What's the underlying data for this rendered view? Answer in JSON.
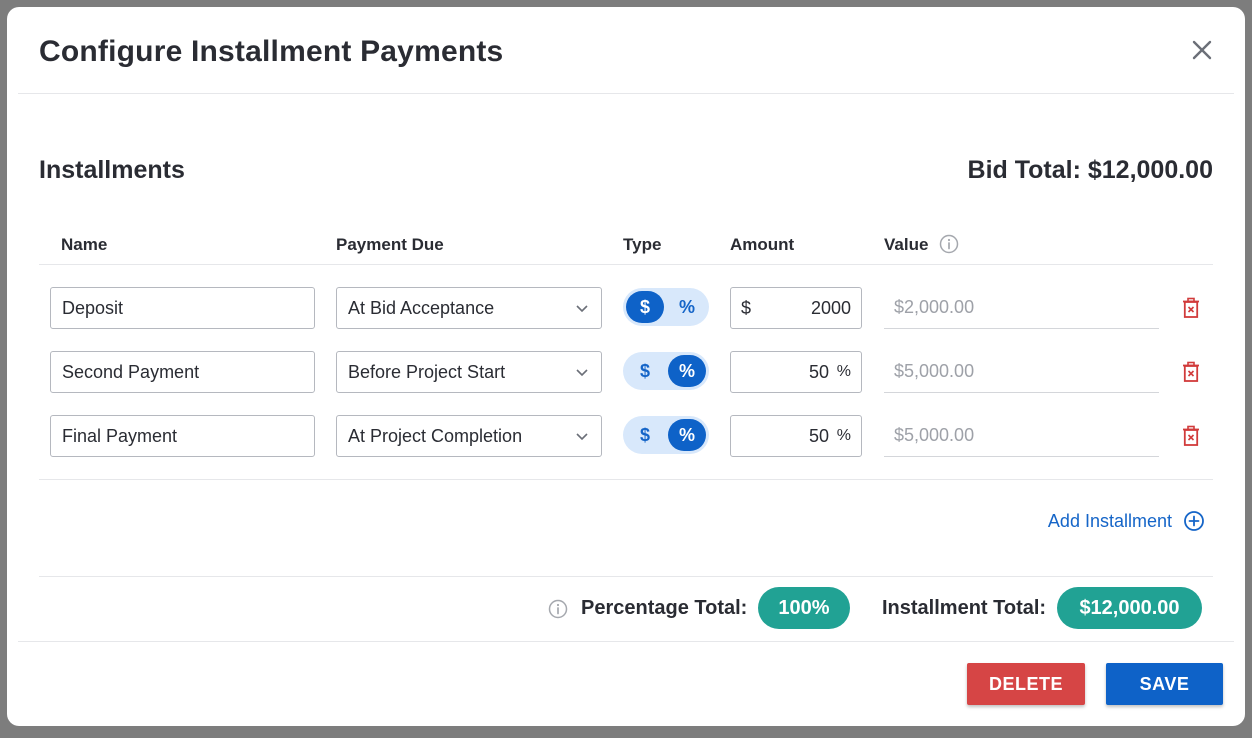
{
  "modal": {
    "title": "Configure Installment Payments",
    "close_icon": "close-icon"
  },
  "section": {
    "title": "Installments",
    "bid_total": "Bid Total: $12,000.00"
  },
  "columns": {
    "name": "Name",
    "payment_due": "Payment Due",
    "type": "Type",
    "amount": "Amount",
    "value": "Value"
  },
  "installments": [
    {
      "name": "Deposit",
      "payment_due": "At Bid Acceptance",
      "type_dollar": "$",
      "type_percent": "%",
      "active_type": "dollar",
      "amount_prefix": "$",
      "amount": "2000",
      "amount_suffix": "",
      "value": "$2,000.00"
    },
    {
      "name": "Second Payment",
      "payment_due": "Before Project Start",
      "type_dollar": "$",
      "type_percent": "%",
      "active_type": "percent",
      "amount_prefix": "",
      "amount": "50",
      "amount_suffix": "%",
      "value": "$5,000.00"
    },
    {
      "name": "Final Payment",
      "payment_due": "At Project Completion",
      "type_dollar": "$",
      "type_percent": "%",
      "active_type": "percent",
      "amount_prefix": "",
      "amount": "50",
      "amount_suffix": "%",
      "value": "$5,000.00"
    }
  ],
  "add_installment": "Add Installment",
  "totals": {
    "percentage_label": "Percentage Total:",
    "percentage_value": "100%",
    "installment_label": "Installment Total:",
    "installment_value": "$12,000.00"
  },
  "actions": {
    "delete": "DELETE",
    "save": "SAVE"
  },
  "colors": {
    "accent_blue": "#0e62c8",
    "delete_red": "#d64545",
    "teal": "#21a294",
    "trash_red": "#d13b3b"
  }
}
